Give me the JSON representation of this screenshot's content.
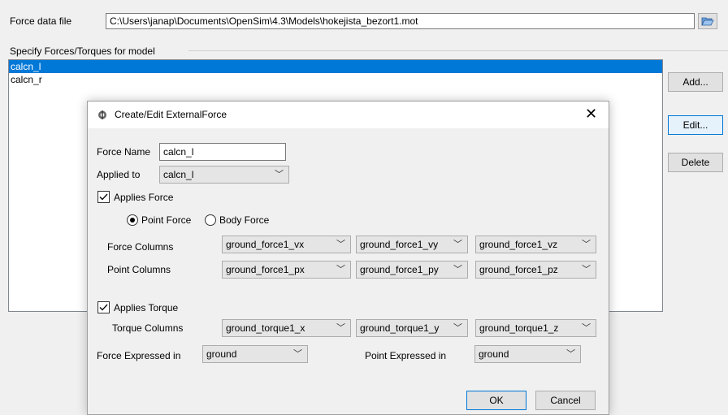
{
  "file_row": {
    "label": "Force data file",
    "path": "C:\\Users\\janap\\Documents\\OpenSim\\4.3\\Models\\hokejista_bezort1.mot"
  },
  "group_title": "Specify Forces/Torques for model",
  "forces_list": [
    {
      "label": "calcn_l",
      "selected": true
    },
    {
      "label": "calcn_r",
      "selected": false
    }
  ],
  "side_buttons": {
    "add": "Add...",
    "edit": "Edit...",
    "delete": "Delete"
  },
  "dialog": {
    "title": "Create/Edit ExternalForce",
    "force_name_label": "Force Name",
    "force_name_value": "calcn_l",
    "applied_to_label": "Applied to",
    "applied_to_value": "calcn_l",
    "applies_force_label": "Applies Force",
    "applies_force_checked": true,
    "point_force_label": "Point Force",
    "body_force_label": "Body Force",
    "point_force_selected": true,
    "force_columns_label": "Force Columns",
    "force_columns": [
      "ground_force1_vx",
      "ground_force1_vy",
      "ground_force1_vz"
    ],
    "point_columns_label": "Point Columns",
    "point_columns": [
      "ground_force1_px",
      "ground_force1_py",
      "ground_force1_pz"
    ],
    "applies_torque_label": "Applies Torque",
    "applies_torque_checked": true,
    "torque_columns_label": "Torque Columns",
    "torque_columns": [
      "ground_torque1_x",
      "ground_torque1_y",
      "ground_torque1_z"
    ],
    "force_expressed_label": "Force Expressed in",
    "force_expressed_value": "ground",
    "point_expressed_label": "Point Expressed in",
    "point_expressed_value": "ground",
    "ok_label": "OK",
    "cancel_label": "Cancel"
  },
  "icons": {
    "browse": "folder-open-icon",
    "dialog": "opensim-icon",
    "close": "close-icon",
    "dropdown": "chevron-down-icon",
    "check": "checkmark-icon"
  }
}
